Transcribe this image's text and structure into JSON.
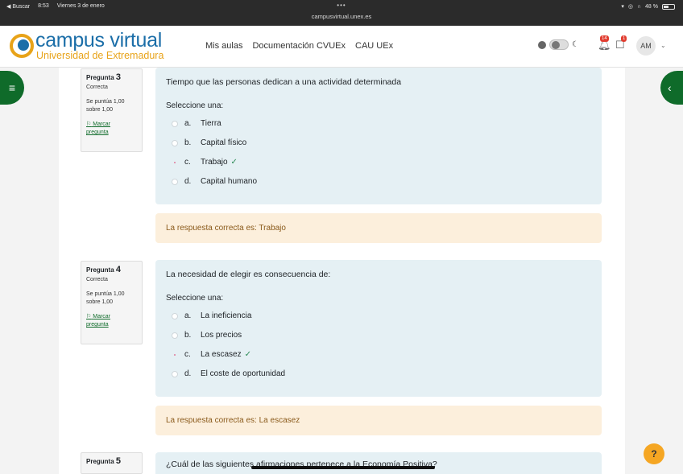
{
  "status_bar": {
    "back_app": "◀ Buscar",
    "time": "8:53",
    "date": "Viernes 3 de enero",
    "dots": "•••",
    "url": "campusvirtual.unex.es",
    "battery": "48 %"
  },
  "header": {
    "logo_title": "campus virtual",
    "logo_subtitle": "Universidad de Extremadura",
    "nav": [
      "Mis aulas",
      "Documentación CVUEx",
      "CAU UEx"
    ],
    "notif_badge": "14",
    "msg_badge": "1",
    "avatar_initials": "AM"
  },
  "questions": [
    {
      "label": "Pregunta",
      "number": "3",
      "state": "Correcta",
      "grade_line1": "Se puntúa 1,00",
      "grade_line2": "sobre 1,00",
      "flag_line1": "Marcar",
      "flag_line2": "pregunta",
      "text": "Tiempo que las personas dedican a una actividad determinada",
      "prompt": "Seleccione una:",
      "options": [
        {
          "letter": "a.",
          "text": "Tierra"
        },
        {
          "letter": "b.",
          "text": "Capital físico"
        },
        {
          "letter": "c.",
          "text": "Trabajo"
        },
        {
          "letter": "d.",
          "text": "Capital humano"
        }
      ],
      "feedback": "La respuesta correcta es: Trabajo"
    },
    {
      "label": "Pregunta",
      "number": "4",
      "state": "Correcta",
      "grade_line1": "Se puntúa 1,00",
      "grade_line2": "sobre 1,00",
      "flag_line1": "Marcar",
      "flag_line2": "pregunta",
      "text": "La necesidad de elegir es consecuencia de:",
      "prompt": "Seleccione una:",
      "options": [
        {
          "letter": "a.",
          "text": "La ineficiencia"
        },
        {
          "letter": "b.",
          "text": "Los precios"
        },
        {
          "letter": "c.",
          "text": "La escasez"
        },
        {
          "letter": "d.",
          "text": "El coste de oportunidad"
        }
      ],
      "feedback": "La respuesta correcta es: La escasez"
    },
    {
      "label": "Pregunta",
      "number": "5",
      "text": "¿Cuál de las siguientes afirmaciones pertenece a la Economía Positiva?"
    }
  ],
  "help_label": "?"
}
